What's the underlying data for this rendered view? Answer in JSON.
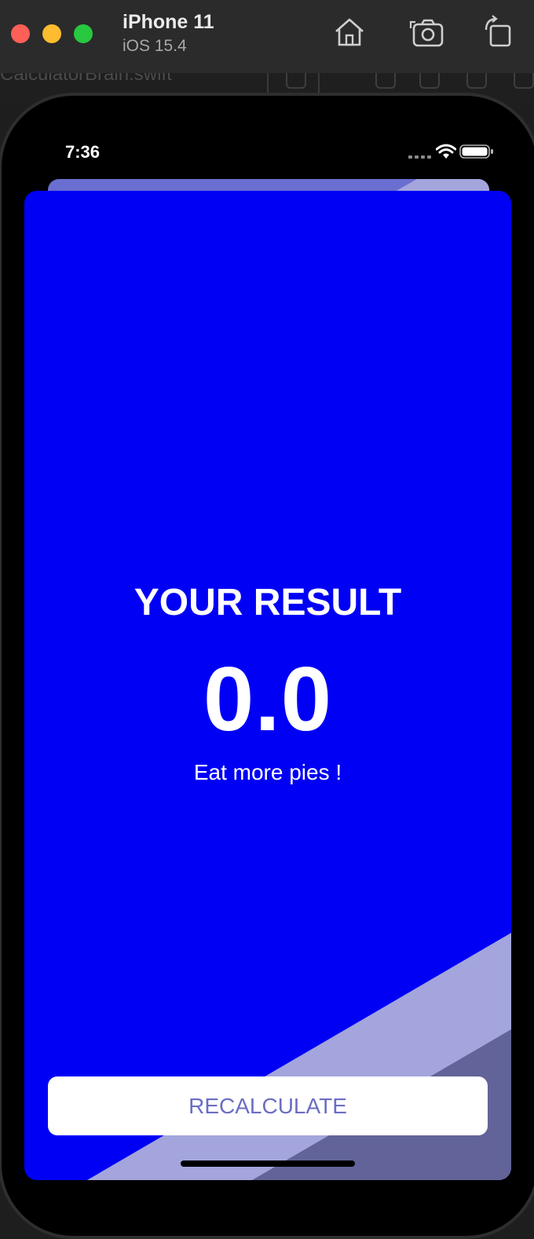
{
  "simulator": {
    "device_name": "iPhone 11",
    "os_version": "iOS 15.4",
    "toolbar_icons": [
      "home-icon",
      "screenshot-camera-icon",
      "rotate-icon"
    ]
  },
  "editor_behind": {
    "file_tab": "CalculatorBrain.swift"
  },
  "status_bar": {
    "time": "7:36",
    "icons": [
      "signal-icon",
      "wifi-icon",
      "battery-icon"
    ]
  },
  "result_screen": {
    "title": "YOUR RESULT",
    "value": "0.0",
    "advice": "Eat more pies !",
    "button_label": "RECALCULATE",
    "colors": {
      "background": "#0000F5",
      "stripe_light": "#A3A5DC",
      "stripe_dark": "#626499",
      "button_text": "#6B6EC2"
    }
  }
}
